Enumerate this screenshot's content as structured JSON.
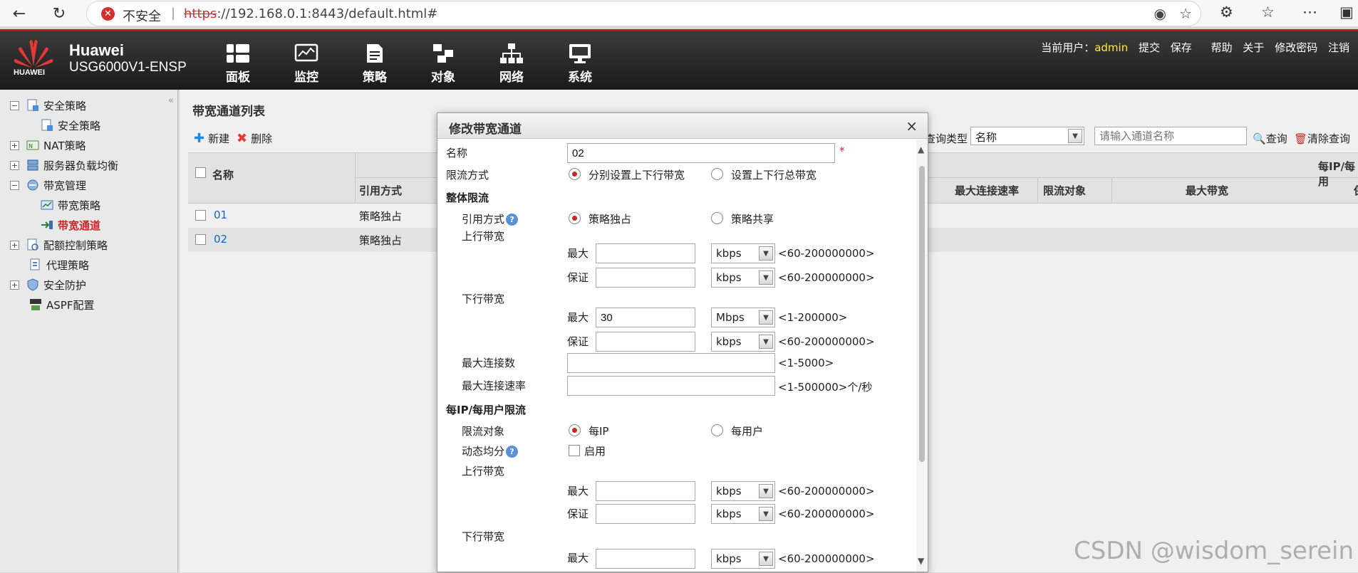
{
  "browser": {
    "security_label": "不安全",
    "url_scheme": "https",
    "url_rest": "://192.168.0.1:8443/default.html#"
  },
  "header": {
    "logo_text": "HUAWEI",
    "brand": "Huawei",
    "model": "USG6000V1-ENSP",
    "nav": [
      {
        "label": "面板",
        "icon": "dashboard-icon"
      },
      {
        "label": "监控",
        "icon": "monitor-icon"
      },
      {
        "label": "策略",
        "icon": "policy-icon"
      },
      {
        "label": "对象",
        "icon": "object-icon"
      },
      {
        "label": "网络",
        "icon": "network-icon"
      },
      {
        "label": "系统",
        "icon": "system-icon"
      }
    ],
    "current_user_label": "当前用户：",
    "current_user": "admin",
    "links": [
      "提交",
      "保存",
      "帮助",
      "关于",
      "修改密码",
      "注销"
    ],
    "accent_color": "#b71c1c"
  },
  "sidebar": {
    "items": [
      {
        "label": "安全策略",
        "level": 0,
        "toggle": "−"
      },
      {
        "label": "安全策略",
        "level": 1
      },
      {
        "label": "NAT策略",
        "level": 0,
        "toggle": "+"
      },
      {
        "label": "服务器负载均衡",
        "level": 0,
        "toggle": "+"
      },
      {
        "label": "带宽管理",
        "level": 0,
        "toggle": "−"
      },
      {
        "label": "带宽策略",
        "level": 1
      },
      {
        "label": "带宽通道",
        "level": 1,
        "active": true
      },
      {
        "label": "配额控制策略",
        "level": 0,
        "toggle": "+"
      },
      {
        "label": "代理策略",
        "level": 0
      },
      {
        "label": "安全防护",
        "level": 0,
        "toggle": "+"
      },
      {
        "label": "ASPF配置",
        "level": 0
      }
    ]
  },
  "main": {
    "title": "带宽通道列表",
    "toolbar": {
      "new_label": "新建",
      "delete_label": "删除"
    },
    "search": {
      "type_label": "查询类型",
      "type_value": "名称",
      "placeholder": "请输入通道名称",
      "query_label": "查询",
      "clear_label": "清除查询"
    },
    "columns": {
      "name": "名称",
      "ref_mode": "引用方式",
      "max_conn_rate": "最大连接速率",
      "limit_target": "限流对象",
      "max_bw": "最大带宽",
      "per_ip_group": "每IP/每用",
      "cut": "保"
    },
    "rows": [
      {
        "name": "01",
        "ref_mode": "策略独占"
      },
      {
        "name": "02",
        "ref_mode": "策略独占"
      }
    ]
  },
  "dialog": {
    "title": "修改带宽通道",
    "name_label": "名称",
    "name_value": "02",
    "limit_mode_label": "限流方式",
    "limit_mode_opt1": "分别设置上下行带宽",
    "limit_mode_opt2": "设置上下行总带宽",
    "overall_section": "整体限流",
    "ref_mode_label": "引用方式",
    "ref_opt1": "策略独占",
    "ref_opt2": "策略共享",
    "up_bw_label": "上行带宽",
    "down_bw_label": "下行带宽",
    "max_label": "最大",
    "guarantee_label": "保证",
    "unit_kbps": "kbps",
    "unit_mbps": "Mbps",
    "range_kbps": "<60-200000000>",
    "range_mbps": "<1-200000>",
    "down_max_value": "30",
    "max_conn_label": "最大连接数",
    "max_conn_range": "<1-5000>",
    "max_conn_rate_label": "最大连接速率",
    "max_conn_rate_range": "<1-500000>个/秒",
    "per_section": "每IP/每用户限流",
    "target_label": "限流对象",
    "target_opt1": "每IP",
    "target_opt2": "每用户",
    "dyn_label": "动态均分",
    "dyn_enable": "启用",
    "help_glyph": "?",
    "close_glyph": "×"
  },
  "watermark": "CSDN @wisdom_serein"
}
